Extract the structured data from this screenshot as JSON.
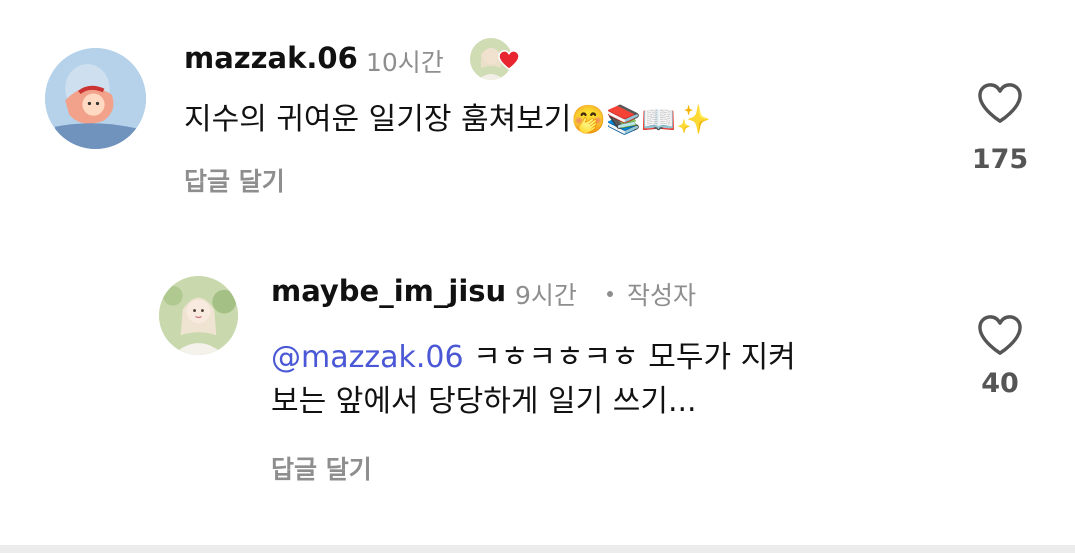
{
  "comments": [
    {
      "username": "mazzak.06",
      "time": "10시간",
      "text": "지수의 귀여운 일기장 훔쳐보기",
      "emojis": "🤭📚📖✨",
      "reply_label": "답글 달기",
      "like_count": "175",
      "liked_by_author": true,
      "icons": {
        "like": "heart-outline-icon",
        "liked_by_author": "red-heart-icon"
      }
    },
    {
      "username": "maybe_im_jisu",
      "time": "9시간",
      "author_badge": "작성자",
      "mention": "@mazzak.06",
      "text_line1": " ㅋㅎㅋㅎㅋㅎ 모두가 지켜",
      "text_line2": "보는 앞에서 당당하게 일기 쓰기...",
      "reply_label": "답글 달기",
      "like_count": "40",
      "icons": {
        "like": "heart-outline-icon"
      }
    }
  ],
  "colors": {
    "text_primary": "#111111",
    "text_secondary": "#8e8e8e",
    "mention": "#4a58d6",
    "heart_red": "#e8262f"
  }
}
